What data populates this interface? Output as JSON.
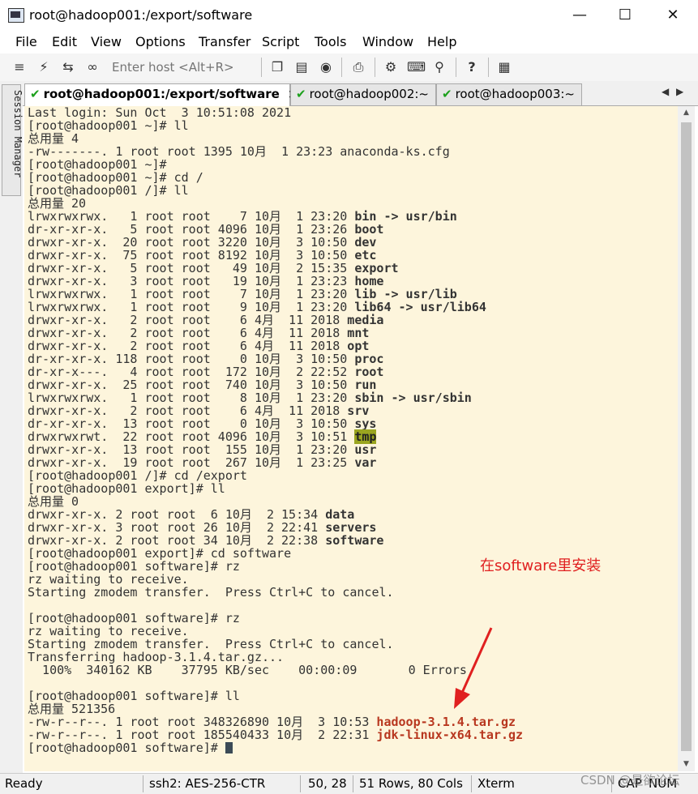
{
  "window": {
    "title": "root@hadoop001:/export/software"
  },
  "menu": [
    "File",
    "Edit",
    "View",
    "Options",
    "Transfer",
    "Script",
    "Tools",
    "Window",
    "Help"
  ],
  "toolbar": {
    "host_placeholder": "Enter host <Alt+R>"
  },
  "session_manager": {
    "label": "Session Manager"
  },
  "tabs": [
    {
      "label": "root@hadoop001:/export/software",
      "close": "×"
    },
    {
      "label": "root@hadoop002:~"
    },
    {
      "label": "root@hadoop003:~"
    }
  ],
  "terminal": {
    "lines": [
      "Last login: Sun Oct  3 10:51:08 2021",
      "[root@hadoop001 ~]# ll",
      "总用量 4",
      "-rw-------. 1 root root 1395 10月  1 23:23 anaconda-ks.cfg",
      "[root@hadoop001 ~]#",
      "[root@hadoop001 ~]# cd /",
      "[root@hadoop001 /]# ll",
      "总用量 20",
      "lrwxrwxrwx.   1 root root    7 10月  1 23:20 ",
      "dr-xr-xr-x.   5 root root 4096 10月  1 23:26 ",
      "drwxr-xr-x.  20 root root 3220 10月  3 10:50 ",
      "drwxr-xr-x.  75 root root 8192 10月  3 10:50 ",
      "drwxr-xr-x.   5 root root   49 10月  2 15:35 ",
      "drwxr-xr-x.   3 root root   19 10月  1 23:23 ",
      "lrwxrwxrwx.   1 root root    7 10月  1 23:20 ",
      "lrwxrwxrwx.   1 root root    9 10月  1 23:20 ",
      "drwxr-xr-x.   2 root root    6 4月  11 2018 ",
      "drwxr-xr-x.   2 root root    6 4月  11 2018 ",
      "drwxr-xr-x.   2 root root    6 4月  11 2018 ",
      "dr-xr-xr-x. 118 root root    0 10月  3 10:50 ",
      "dr-xr-x---.   4 root root  172 10月  2 22:52 ",
      "drwxr-xr-x.  25 root root  740 10月  3 10:50 ",
      "lrwxrwxrwx.   1 root root    8 10月  1 23:20 ",
      "drwxr-xr-x.   2 root root    6 4月  11 2018 ",
      "dr-xr-xr-x.  13 root root    0 10月  3 10:50 ",
      "drwxrwxrwt.  22 root root 4096 10月  3 10:51 ",
      "drwxr-xr-x.  13 root root  155 10月  1 23:20 ",
      "drwxr-xr-x.  19 root root  267 10月  1 23:25 ",
      "[root@hadoop001 /]# cd /export",
      "[root@hadoop001 export]# ll",
      "总用量 0",
      "drwxr-xr-x. 2 root root  6 10月  2 15:34 ",
      "drwxr-xr-x. 3 root root 26 10月  2 22:41 ",
      "drwxr-xr-x. 2 root root 34 10月  2 22:38 ",
      "[root@hadoop001 export]# cd software",
      "[root@hadoop001 software]# rz",
      "rz waiting to receive.",
      "Starting zmodem transfer.  Press Ctrl+C to cancel.",
      "",
      "[root@hadoop001 software]# rz",
      "rz waiting to receive.",
      "Starting zmodem transfer.  Press Ctrl+C to cancel.",
      "Transferring hadoop-3.1.4.tar.gz...",
      "  100%  340162 KB    37795 KB/sec    00:00:09       0 Errors",
      "",
      "[root@hadoop001 software]# ll",
      "总用量 521356",
      "-rw-r--r--. 1 root root 348326890 10月  3 10:53 ",
      "-rw-r--r--. 1 root root 185540433 10月  2 22:31 ",
      "[root@hadoop001 software]# "
    ],
    "names": {
      "8": "bin -> usr/bin",
      "9": "boot",
      "10": "dev",
      "11": "etc",
      "12": "export",
      "13": "home",
      "14": "lib -> usr/lib",
      "15": "lib64 -> usr/lib64",
      "16": "media",
      "17": "mnt",
      "18": "opt",
      "19": "proc",
      "20": "root",
      "21": "run",
      "22": "sbin -> usr/sbin",
      "23": "srv",
      "24": "sys",
      "25": "tmp",
      "26": "usr",
      "27": "var",
      "31": "data",
      "32": "servers",
      "33": "software",
      "47": "hadoop-3.1.4.tar.gz",
      "48": "jdk-linux-x64.tar.gz"
    }
  },
  "annotation": {
    "text": "在software里安装",
    "color": "#e02020"
  },
  "status": {
    "ready": "Ready",
    "cipher": "ssh2: AES-256-CTR",
    "cursor": "50,  28",
    "size": "51 Rows, 80 Cols",
    "term": "Xterm",
    "caps": "CAP",
    "num": "NUM"
  },
  "watermark": "CSDN @是欲论坛"
}
